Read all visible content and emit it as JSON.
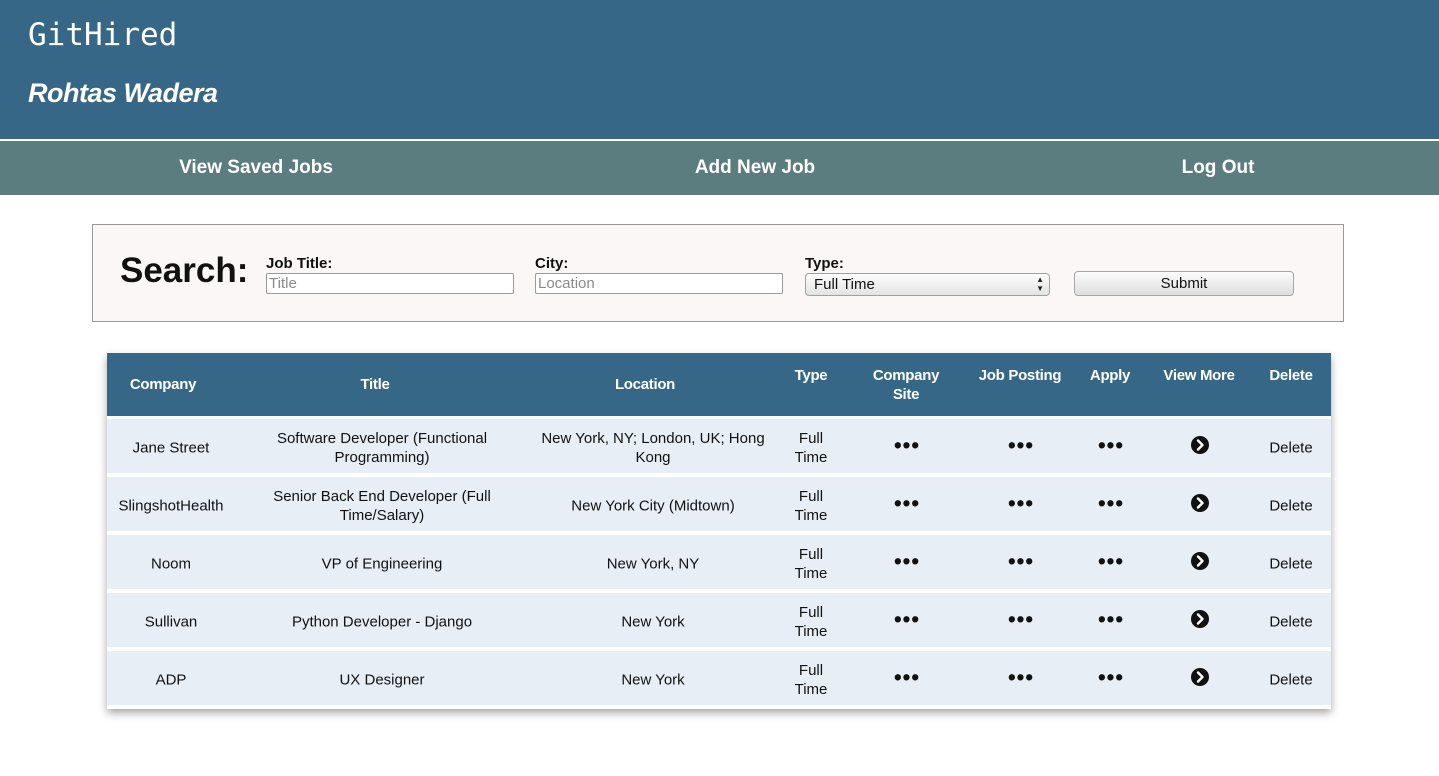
{
  "header": {
    "brand": "GitHired",
    "username": "Rohtas Wadera"
  },
  "nav": {
    "saved": "View Saved Jobs",
    "add": "Add New Job",
    "logout": "Log Out"
  },
  "search": {
    "label": "Search:",
    "title_label": "Job Title:",
    "title_placeholder": "Title",
    "city_label": "City:",
    "city_placeholder": "Location",
    "type_label": "Type:",
    "type_value": "Full Time",
    "submit": "Submit"
  },
  "table": {
    "headers": {
      "company": "Company",
      "title": "Title",
      "location": "Location",
      "type": "Type",
      "company_site_1": "Company",
      "company_site_2": "Site",
      "job_posting": "Job Posting",
      "apply": "Apply",
      "view_more": "View More",
      "delete": "Delete"
    },
    "dots": "•••",
    "rows": [
      {
        "company": "Jane Street",
        "title_1": "Software Developer (Functional",
        "title_2": "Programming)",
        "location_1": "New York, NY; London, UK; Hong",
        "location_2": "Kong",
        "type_1": "Full",
        "type_2": "Time",
        "delete": "Delete"
      },
      {
        "company": "SlingshotHealth",
        "title_1": "Senior Back End Developer (Full",
        "title_2": "Time/Salary)",
        "location_1": "New York City (Midtown)",
        "location_2": "",
        "type_1": "Full",
        "type_2": "Time",
        "delete": "Delete"
      },
      {
        "company": "Noom",
        "title_1": "VP of Engineering",
        "title_2": "",
        "location_1": "New York, NY",
        "location_2": "",
        "type_1": "Full",
        "type_2": "Time",
        "delete": "Delete"
      },
      {
        "company": "Sullivan",
        "title_1": "Python Developer - Django",
        "title_2": "",
        "location_1": "New York",
        "location_2": "",
        "type_1": "Full",
        "type_2": "Time",
        "delete": "Delete"
      },
      {
        "company": "ADP",
        "title_1": "UX Designer",
        "title_2": "",
        "location_1": "New York",
        "location_2": "",
        "type_1": "Full",
        "type_2": "Time",
        "delete": "Delete"
      }
    ]
  }
}
